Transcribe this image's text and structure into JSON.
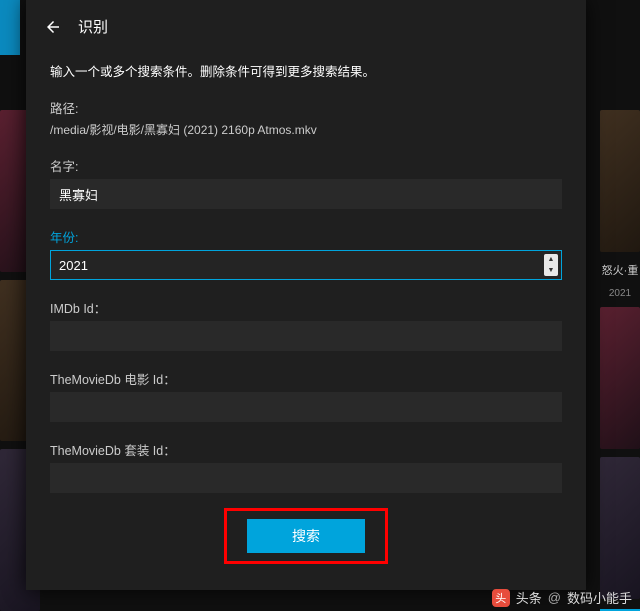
{
  "modal": {
    "title": "识别",
    "instruction": "输入一个或多个搜索条件。删除条件可得到更多搜索结果。",
    "path_label": "路径:",
    "path_value": "/media/影视/电影/黑寡妇 (2021) 2160p Atmos.mkv",
    "name_label": "名字:",
    "name_value": "黑寡妇",
    "year_label": "年份:",
    "year_value": "2021",
    "imdb_label": "IMDb Id：",
    "imdb_value": "",
    "tmdb_movie_label": "TheMovieDb 电影 Id：",
    "tmdb_movie_value": "",
    "tmdb_collection_label": "TheMovieDb 套装 Id：",
    "tmdb_collection_value": "",
    "search_button": "搜索"
  },
  "background": {
    "right_movie_title": "怒火·重",
    "right_movie_year": "2021"
  },
  "watermark": {
    "prefix": "头条",
    "at": "@",
    "author": "数码小能手"
  }
}
